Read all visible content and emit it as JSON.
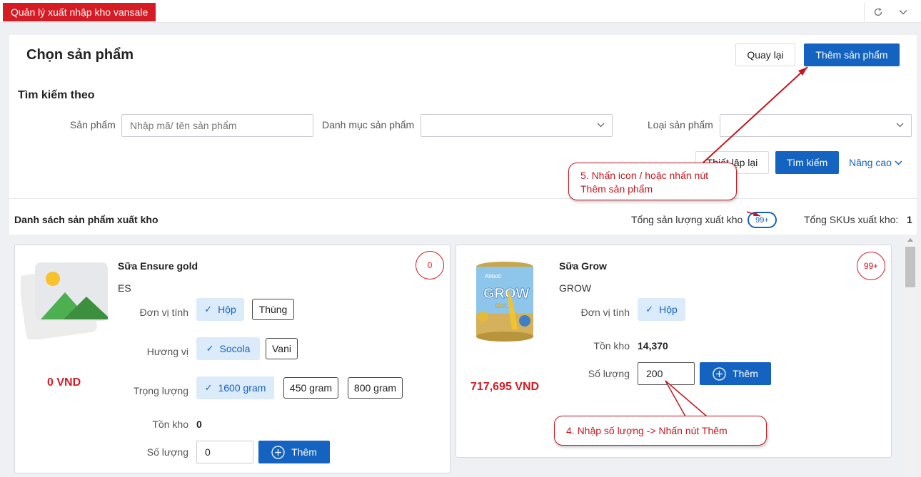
{
  "app": {
    "tab_title": "Quản lý xuất nhập kho vansale"
  },
  "colors": {
    "brand_red": "#d51b23",
    "primary_blue": "#1463c0"
  },
  "header": {
    "title": "Chọn sản phẩm",
    "back_label": "Quay lại",
    "add_product_label": "Thêm sản phẩm"
  },
  "search": {
    "title": "Tìm kiếm theo",
    "product_label": "Sản phẩm",
    "product_placeholder": "Nhập mã/ tên sản phẩm",
    "category_label": "Danh mục sản phẩm",
    "category_value": "",
    "type_label": "Loại sản phẩm",
    "type_value": "",
    "reset_label": "Thiết lập lại",
    "search_label": "Tìm kiếm",
    "advanced_label": "Nâng cao"
  },
  "list": {
    "title": "Danh sách sản phẩm xuất kho",
    "total_qty_label": "Tổng sản lượng xuất kho",
    "total_qty_badge": "99+",
    "total_sku_label": "Tổng SKUs xuất kho:",
    "total_sku_value": "1"
  },
  "products": [
    {
      "name": "Sữa Ensure gold",
      "code": "ES",
      "badge": "0",
      "price": "0 VND",
      "unit_label": "Đơn vị tính",
      "units": [
        "Hộp",
        "Thùng"
      ],
      "flavor_label": "Hương vị",
      "flavors": [
        "Socola",
        "Vani"
      ],
      "weight_label": "Trọng lượng",
      "weights": [
        "1600 gram",
        "450 gram",
        "800 gram"
      ],
      "stock_label": "Tồn kho",
      "stock": "0",
      "qty_label": "Số lượng",
      "qty": "0",
      "add_label": "Thêm",
      "image_icon": "image-placeholder-icon"
    },
    {
      "name": "Sữa Grow",
      "code": "GROW",
      "badge": "99+",
      "price": "717,695 VND",
      "unit_label": "Đơn vị tính",
      "units": [
        "Hộp"
      ],
      "stock_label": "Tồn kho",
      "stock": "14,370",
      "qty_label": "Số lượng",
      "qty": "200",
      "add_label": "Thêm",
      "image_brand": "Abbott",
      "image_title": "GROW",
      "image_sub": "GOLD"
    }
  ],
  "annotations": {
    "step5_line1": "5. Nhấn icon / hoặc nhấn nút",
    "step5_line2": "Thêm sản phẩm",
    "step4": "4. Nhập số lượng -> Nhấn nút Thêm"
  }
}
